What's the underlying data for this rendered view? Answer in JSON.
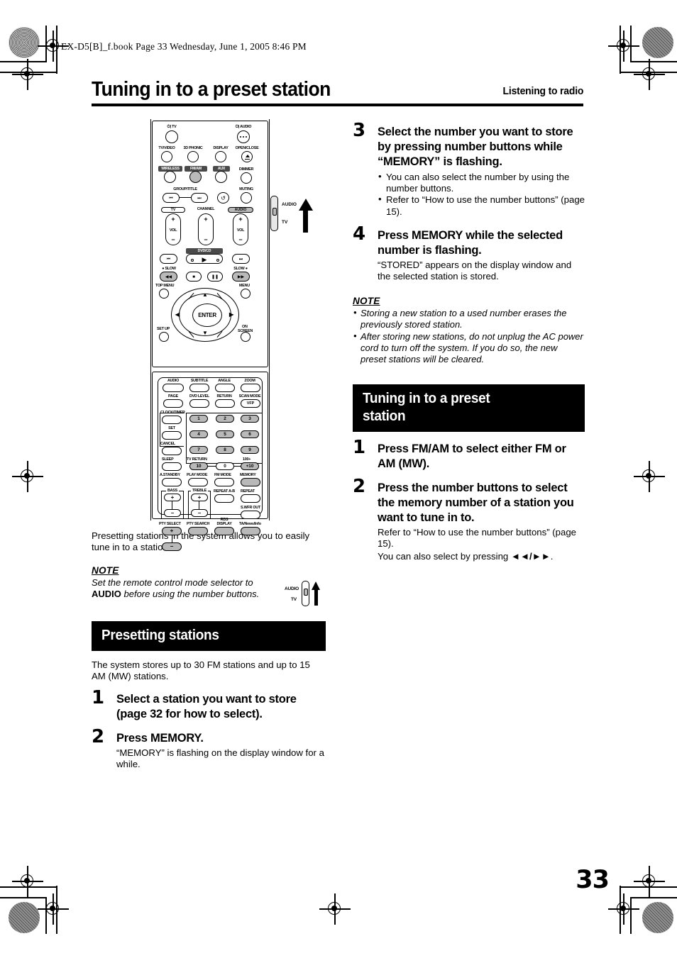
{
  "header": {
    "bookline": "EX-D5[B]_f.book  Page 33  Wednesday, June 1, 2005  8:46 PM",
    "title": "Tuning in to a preset station",
    "subtitle": "Listening to radio"
  },
  "page_number": "33",
  "left_column": {
    "intro": "Presetting stations in the system allows you to easily tune in to a station.",
    "note_heading": "NOTE",
    "note_text_italic_a": "Set the remote control mode selector to ",
    "note_text_bold": "AUDIO",
    "note_text_italic_b": " before using the number buttons.",
    "selector_icon": {
      "top_label": "AUDIO",
      "bottom_label": "TV"
    },
    "section_bar": "Presetting stations",
    "section_intro": "The system stores up to 30 FM stations and up to 15 AM (MW) stations.",
    "steps": [
      {
        "num": "1",
        "head": "Select a station you want to store (page 32 for how to select).",
        "sub": ""
      },
      {
        "num": "2",
        "head": "Press MEMORY.",
        "sub": "“MEMORY” is flashing on the display window for a while."
      }
    ]
  },
  "right_column": {
    "steps_top": [
      {
        "num": "3",
        "head": "Select the number you want to store by pressing number buttons while “MEMORY” is flashing.",
        "bullets": [
          "You can also select the number by using the number buttons.",
          "Refer to “How to use the number buttons” (page 15)."
        ]
      },
      {
        "num": "4",
        "head": "Press MEMORY while the selected number is flashing.",
        "sub": "“STORED” appears on the display window and the selected station is stored."
      }
    ],
    "note_heading": "NOTE",
    "notes": [
      "Storing a new station to a used number erases the previously stored station.",
      "After storing new stations, do not unplug the AC power cord to turn off the system. If you do so, the new preset stations will be cleared."
    ],
    "section_bar_line1": "Tuning in to a preset",
    "section_bar_line2": "station",
    "steps_bottom": [
      {
        "num": "1",
        "head": "Press FM/AM to select either FM or AM (MW).",
        "sub": ""
      },
      {
        "num": "2",
        "head": "Press the number buttons to select the memory number of a station you want to tune in to.",
        "sub_line1": "Refer to “How to use the number buttons” (page 15).",
        "sub_line2_pre": "You can also select by pressing ",
        "sub_line2_symbols": "◄◄/►►",
        "sub_line2_post": "."
      }
    ]
  },
  "remote": {
    "side_selector": {
      "audio": "AUDIO",
      "tv": "TV"
    },
    "labels": {
      "standby_tv": "TV",
      "standby_audio": "AUDIO",
      "tv_video": "TV/VIDEO",
      "phonic_3d": "3D PHONIC",
      "display": "DISPLAY",
      "open_close": "OPEN/CLOSE",
      "wireless": "WIRELESS",
      "fm_am": "FM/AM",
      "aux": "AUX",
      "dimmer": "DIMMER",
      "group_title": "GROUP/TITLE",
      "muting": "MUTING",
      "tv_vol": "TV",
      "channel": "CHANNEL",
      "audio_vol": "AUDIO",
      "vol": "VOL",
      "dvd_cd": "DVD/CD",
      "slow_left": "SLOW",
      "slow_right": "SLOW",
      "top_menu": "TOP MENU",
      "menu": "MENU",
      "set_up": "SET UP",
      "on_screen_1": "ON",
      "on_screen_2": "SCREEN",
      "enter": "ENTER",
      "audio": "AUDIO",
      "subtitle": "SUBTITLE",
      "angle": "ANGLE",
      "zoom": "ZOOM",
      "page": "PAGE",
      "dvd_level": "DVD LEVEL",
      "return": "RETURN",
      "scan_mode": "SCAN MODE",
      "vfp": "VFP",
      "clock_timer": "CLOCK/TIMER",
      "set": "SET",
      "cancel": "CANCEL",
      "sleep": "SLEEP",
      "tv_return": "TV RETURN",
      "hundred_plus": "100+",
      "a_standby": "A.STANDBY",
      "play_mode": "PLAY MODE",
      "fm_mode": "FM MODE",
      "memory": "MEMORY",
      "bass": "BASS",
      "treble": "TREBLE",
      "repeat_ab": "REPEAT A-B",
      "repeat": "REPEAT",
      "subwoofer_out": "S.WFR OUT",
      "pty_select": "PTY SELECT",
      "pty_search": "PTY SEARCH",
      "rds_1": "RDS",
      "rds_2": "DISPLAY",
      "ta_news_info": "TA/News/Info"
    },
    "numbers": [
      "1",
      "2",
      "3",
      "4",
      "5",
      "6",
      "7",
      "8",
      "9",
      "10",
      "0",
      "+10"
    ]
  }
}
